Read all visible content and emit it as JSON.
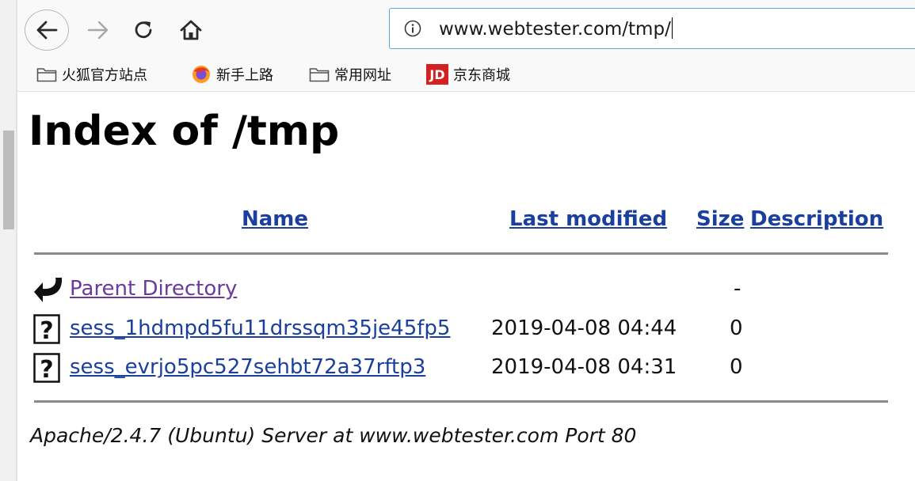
{
  "browser": {
    "url": "www.webtester.com/tmp/",
    "bookmarks": [
      {
        "label": "火狐官方站点",
        "icon": "folder-icon"
      },
      {
        "label": "新手上路",
        "icon": "firefox-icon"
      },
      {
        "label": "常用网址",
        "icon": "folder-icon"
      },
      {
        "label": "京东商城",
        "icon": "jd-logo-icon",
        "icon_text": "JD"
      }
    ]
  },
  "page": {
    "title": "Index of /tmp",
    "columns": {
      "name": "Name",
      "last_modified": "Last modified",
      "size": "Size",
      "description": "Description"
    },
    "rows": [
      {
        "name": "Parent Directory",
        "modified": "",
        "size": "-",
        "icon": "back-arrow-icon"
      },
      {
        "name": "sess_1hdmpd5fu11drssqm35je45fp5",
        "modified": "2019-04-08 04:44",
        "size": "0",
        "icon": "unknown-file-icon"
      },
      {
        "name": "sess_evrjo5pc527sehbt72a37rftp3",
        "modified": "2019-04-08 04:31",
        "size": "0",
        "icon": "unknown-file-icon"
      }
    ],
    "footer": "Apache/2.4.7 (Ubuntu) Server at www.webtester.com Port 80"
  },
  "colors": {
    "link": "#1a3f9e",
    "visited_link": "#6a3a9e",
    "url_focus_border": "#5aa3ec",
    "cursor": "#3ac6d6"
  }
}
